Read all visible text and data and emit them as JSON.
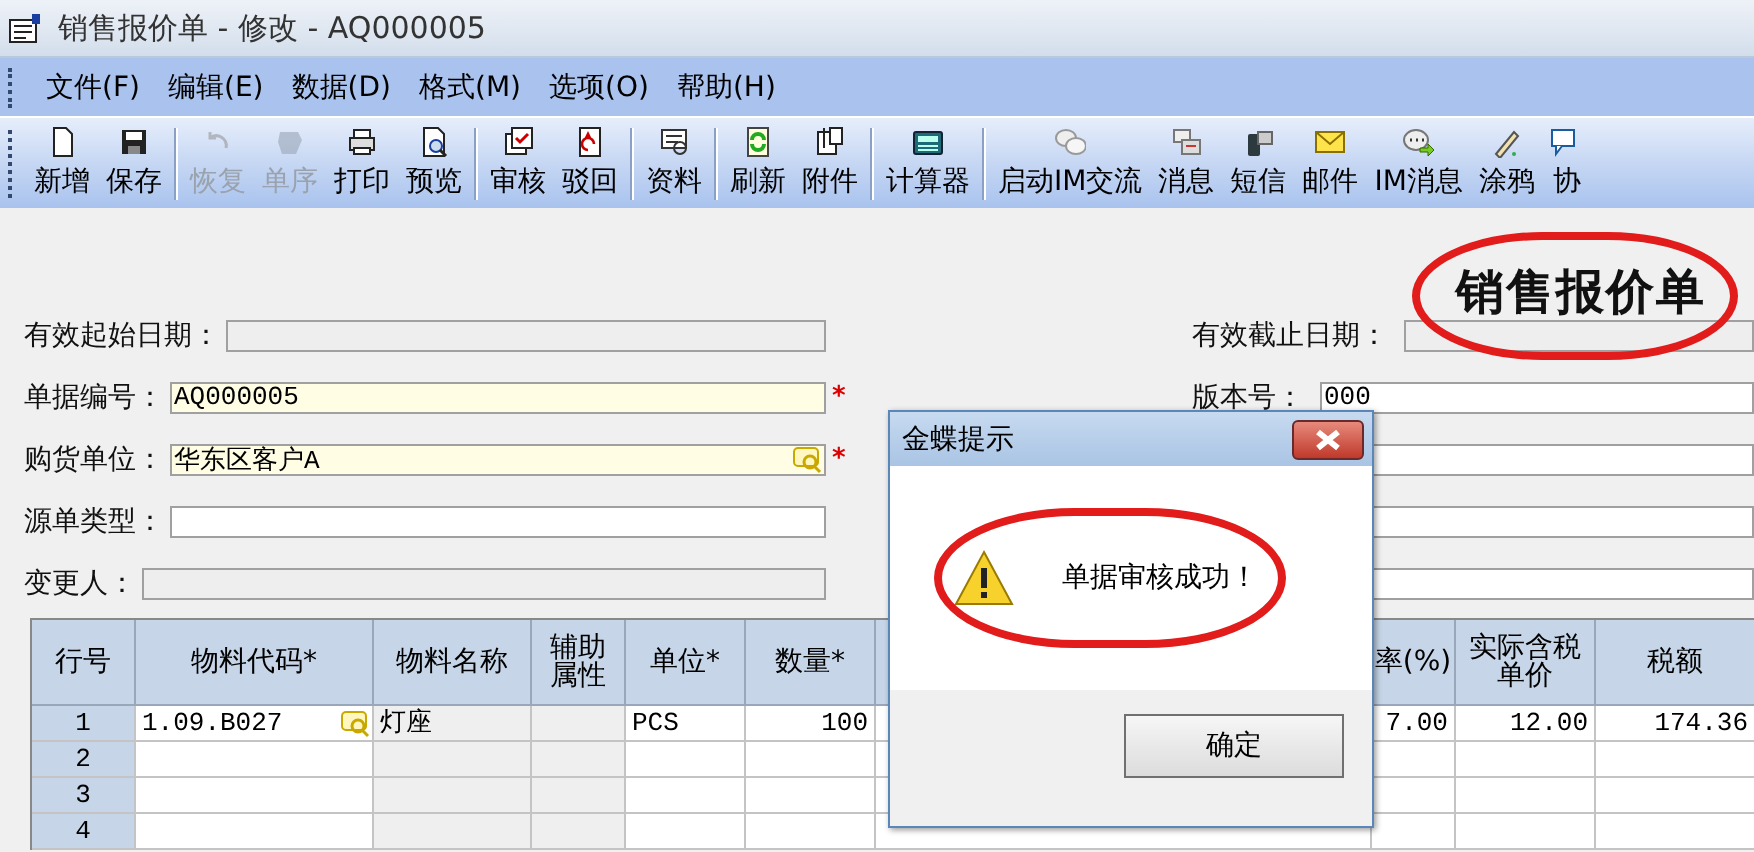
{
  "window": {
    "title": "销售报价单 - 修改 - AQ000005"
  },
  "menu": [
    "文件(F)",
    "编辑(E)",
    "数据(D)",
    "格式(M)",
    "选项(O)",
    "帮助(H)"
  ],
  "toolbar": [
    {
      "label": "新增",
      "disabled": false,
      "separator_before": false
    },
    {
      "label": "保存",
      "disabled": false,
      "separator_before": false
    },
    {
      "label": "恢复",
      "disabled": true,
      "separator_before": true
    },
    {
      "label": "单序",
      "disabled": true,
      "separator_before": false
    },
    {
      "label": "打印",
      "disabled": false,
      "separator_before": false
    },
    {
      "label": "预览",
      "disabled": false,
      "separator_before": false
    },
    {
      "label": "审核",
      "disabled": false,
      "separator_before": true
    },
    {
      "label": "驳回",
      "disabled": false,
      "separator_before": false
    },
    {
      "label": "资料",
      "disabled": false,
      "separator_before": true
    },
    {
      "label": "刷新",
      "disabled": false,
      "separator_before": true
    },
    {
      "label": "附件",
      "disabled": false,
      "separator_before": false
    },
    {
      "label": "计算器",
      "disabled": false,
      "separator_before": true
    },
    {
      "label": "启动IM交流",
      "disabled": false,
      "separator_before": true
    },
    {
      "label": "消息",
      "disabled": false,
      "separator_before": false
    },
    {
      "label": "短信",
      "disabled": false,
      "separator_before": false
    },
    {
      "label": "邮件",
      "disabled": false,
      "separator_before": false
    },
    {
      "label": "IM消息",
      "disabled": false,
      "separator_before": false
    },
    {
      "label": "涂鸦",
      "disabled": false,
      "separator_before": false
    },
    {
      "label": "协",
      "disabled": false,
      "separator_before": false
    }
  ],
  "form_title": {
    "text": "销售报价单",
    "highlighted": true
  },
  "fields_left": [
    {
      "label": "有效起始日期：",
      "kind": "readonly"
    },
    {
      "label": "单据编号：",
      "value": "AQ000005",
      "kind": "required",
      "mark": "*"
    },
    {
      "label": "购货单位：",
      "value": "华东区客户A",
      "kind": "required",
      "mark": "*",
      "lookup": true
    },
    {
      "label": "源单类型：",
      "kind": "plain"
    },
    {
      "label": "变更人：",
      "kind": "readonly"
    }
  ],
  "fields_right": [
    {
      "label": "有效截止日期：",
      "kind": "readonly"
    },
    {
      "label": "版本号：",
      "value": "000",
      "kind": "plain"
    },
    {
      "kind": "plain"
    },
    {
      "kind": "plain"
    },
    {
      "kind": "plain"
    }
  ],
  "table": {
    "columns": [
      "行号",
      "物料代码*",
      "物料名称",
      "辅助属性",
      "单位*",
      "数量*",
      "率(%)",
      "实际含税单价",
      "税额"
    ],
    "rows": [
      {
        "number": "1",
        "lookup": true,
        "cells": [
          "1.09.B027",
          "灯座",
          null,
          "PCS",
          "100",
          "7.00",
          "12.00",
          "174.36"
        ]
      },
      {
        "number": "2"
      },
      {
        "number": "3"
      },
      {
        "number": "4"
      }
    ]
  },
  "dialog": {
    "title": "金蝶提示",
    "message": "单据审核成功！",
    "highlighted": true,
    "button": "确定"
  }
}
